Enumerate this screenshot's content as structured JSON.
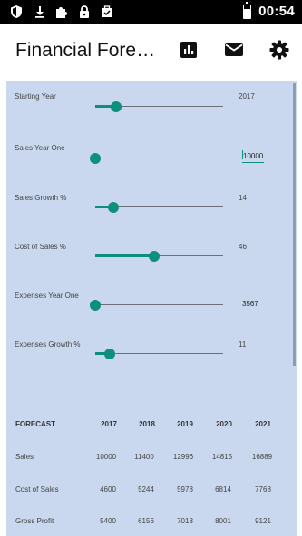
{
  "status_bar": {
    "time": "00:54",
    "icons": [
      "shield-icon",
      "download-icon",
      "puzzle-icon",
      "lock-icon",
      "briefcase-check-icon",
      "battery-icon"
    ]
  },
  "app_bar": {
    "title": "Financial Forecast",
    "icons": [
      "bar-chart-icon",
      "mail-icon",
      "settings-icon"
    ]
  },
  "inputs": [
    {
      "label": "Starting Year",
      "value": "2017",
      "slider_fraction": 0.16
    },
    {
      "label": "Sales Year One",
      "value": "10000",
      "slider_fraction": 0.0,
      "editable": true,
      "focused": true
    },
    {
      "label": "Sales Growth %",
      "value": "14",
      "slider_fraction": 0.14
    },
    {
      "label": "Cost of Sales %",
      "value": "46",
      "slider_fraction": 0.46
    },
    {
      "label": "Expenses Year One",
      "value": "3567",
      "slider_fraction": 0.0,
      "editable": true
    },
    {
      "label": "Expenses Growth %",
      "value": "11",
      "slider_fraction": 0.11
    }
  ],
  "forecast": {
    "header": "FORECAST",
    "years": [
      "2017",
      "2018",
      "2019",
      "2020",
      "2021"
    ],
    "rows": [
      {
        "label": "Sales",
        "values": [
          "10000",
          "11400",
          "12996",
          "14815",
          "16889"
        ]
      },
      {
        "label": "Cost of Sales",
        "values": [
          "4600",
          "5244",
          "5978",
          "6814",
          "7768"
        ]
      },
      {
        "label": "Gross Profit",
        "values": [
          "5400",
          "6156",
          "7018",
          "8001",
          "9121"
        ]
      }
    ]
  },
  "colors": {
    "accent": "#0d8f7e",
    "panel_background": "#c9d8ee",
    "status_bar": "#000000"
  }
}
